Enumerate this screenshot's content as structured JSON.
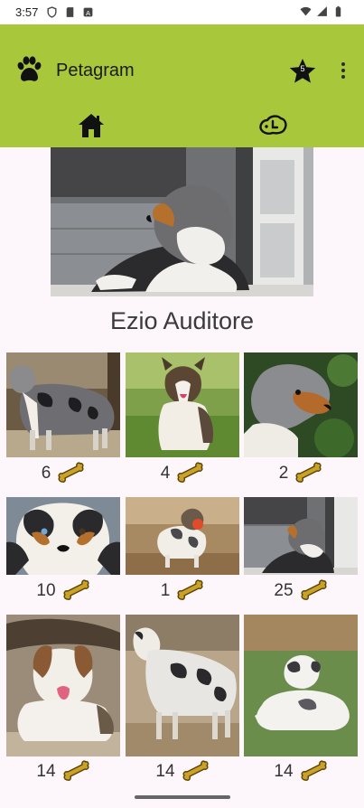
{
  "status_bar": {
    "time": "3:57",
    "left_icons": [
      "shield-icon",
      "sd-card-icon",
      "app-notification-icon"
    ],
    "right_icons": [
      "wifi-icon",
      "signal-icon",
      "battery-icon"
    ]
  },
  "app_bar": {
    "logo_icon": "paw-icon",
    "title": "Petagram",
    "favorites_count": "5",
    "favorites_icon": "star-icon",
    "menu_icon": "more-vert-icon",
    "background_color": "#a9c73a"
  },
  "tabs": [
    {
      "icon": "home-icon",
      "selected": true
    },
    {
      "icon": "dog-profile-icon",
      "selected": false
    }
  ],
  "profile": {
    "name": "Ezio Auditore",
    "hero_photo": "australian-shepherd-lying-at-door"
  },
  "photos": [
    {
      "likes": "6",
      "icon": "bone-icon",
      "scene": "merle-dog-standing"
    },
    {
      "likes": "4",
      "icon": "bone-icon",
      "scene": "dog-sitting-on-grass"
    },
    {
      "likes": "2",
      "icon": "bone-icon",
      "scene": "dog-head-profile"
    },
    {
      "likes": "10",
      "icon": "bone-icon",
      "scene": "dog-face-closeup"
    },
    {
      "likes": "1",
      "icon": "bone-icon",
      "scene": "dog-with-ball"
    },
    {
      "likes": "25",
      "icon": "bone-icon",
      "scene": "dog-lying-at-door"
    },
    {
      "likes": "14",
      "icon": "bone-icon",
      "scene": "dog-lying-under-log"
    },
    {
      "likes": "14",
      "icon": "bone-icon",
      "scene": "dog-walking"
    },
    {
      "likes": "14",
      "icon": "bone-icon",
      "scene": "puppy-on-lawn"
    }
  ],
  "colors": {
    "accent": "#a9c73a",
    "bone": "#c9a227",
    "page_background": "#fdf7fc"
  }
}
